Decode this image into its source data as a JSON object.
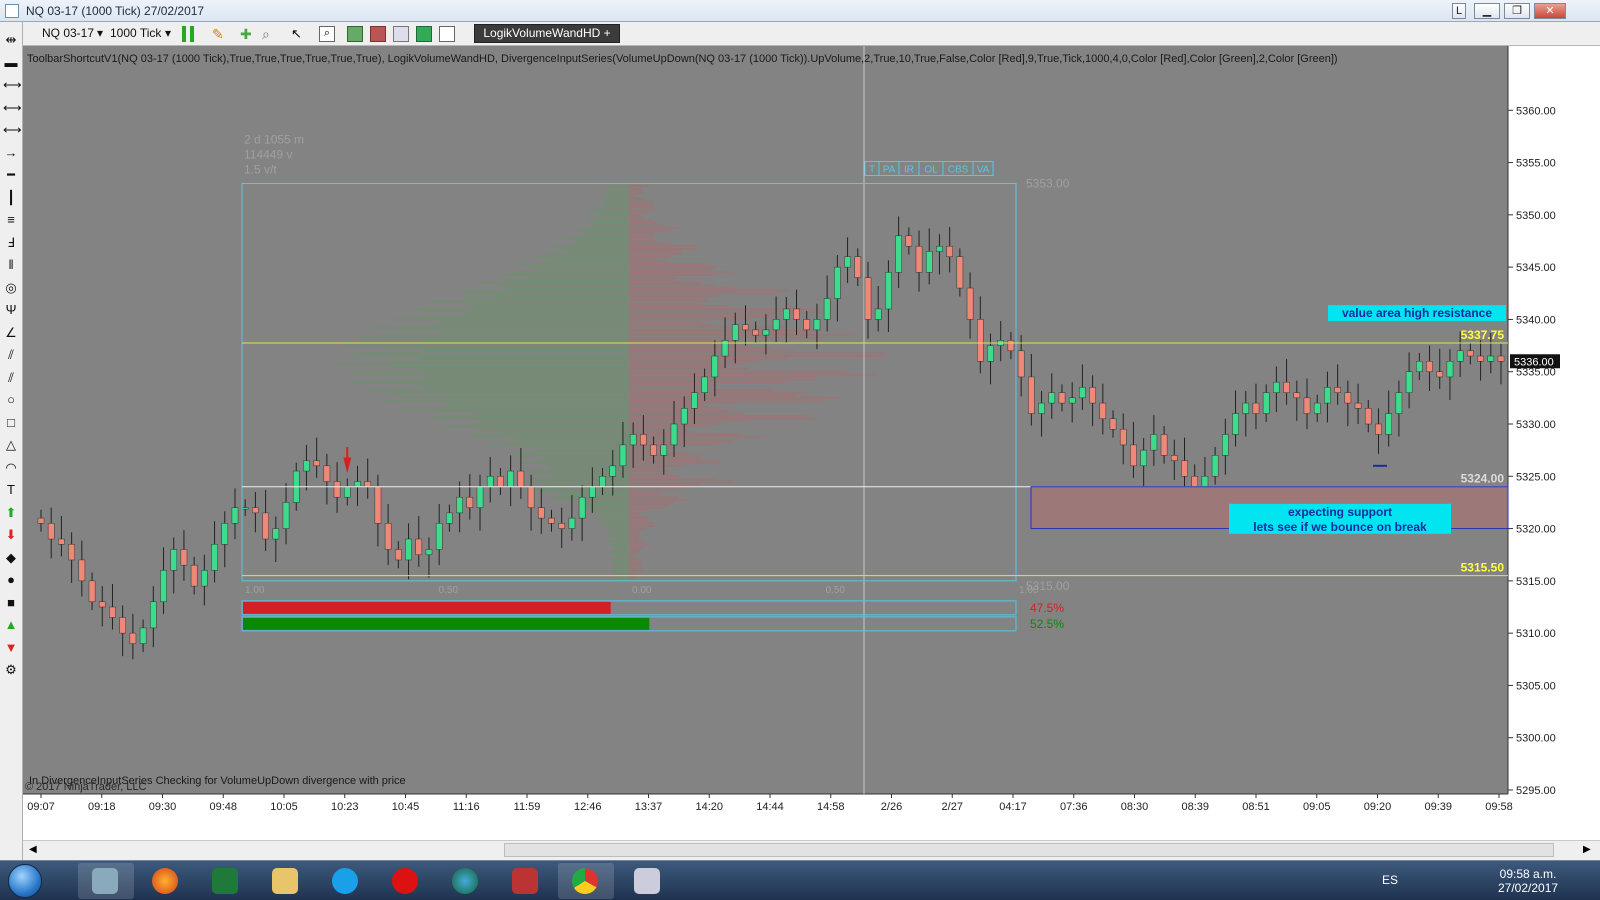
{
  "window": {
    "title": "NQ 03-17 (1000 Tick)  27/02/2017"
  },
  "toolbar": {
    "instrument": "NQ 03-17",
    "interval": "1000 Tick",
    "indicator_button": "LogikVolumeWandHD +"
  },
  "indicator_line": "ToolbarShortcutV1(NQ 03-17 (1000 Tick),True,True,True,True,True,True), LogikVolumeWandHD, DivergenceInputSeries(VolumeUpDown(NQ 03-17 (1000 Tick)).UpVolume,2,True,10,True,False,Color [Red],9,True,Tick,1000,4,0,Color [Red],Color [Green],2,Color [Green])",
  "footer_text": "In DivergenceInputSeries Checking for VolumeUpDown  divergence with price",
  "copyright": "© 2017 NinjaTrader, LLC",
  "colors": {
    "bg": "#838383",
    "up": "#3cdc8c",
    "down": "#f08878",
    "accent_cyan": "#00e5ef",
    "yellow": "#ffff44",
    "grid": "#979797"
  },
  "chart_data": {
    "type": "candlestick",
    "y_axis": {
      "min": 5295,
      "max": 5365,
      "ticks": [
        "5360.00",
        "5355.00",
        "5350.00",
        "5345.00",
        "5340.00",
        "5335.00",
        "5330.00",
        "5325.00",
        "5320.00",
        "5315.00",
        "5310.00",
        "5305.00",
        "5300.00",
        "5295.00"
      ],
      "current_price": "5336.00"
    },
    "x_axis": {
      "ticks": [
        "09:07",
        "09:18",
        "09:30",
        "09:48",
        "10:05",
        "10:23",
        "10:45",
        "11:16",
        "11:59",
        "12:46",
        "13:37",
        "14:20",
        "14:44",
        "14:58",
        "2/26",
        "2/27",
        "04:17",
        "07:36",
        "08:30",
        "08:39",
        "08:51",
        "09:05",
        "09:20",
        "09:39",
        "09:58"
      ]
    },
    "levels": [
      {
        "label": "5337.75",
        "price": 5337.75
      },
      {
        "label": "5324.00",
        "price": 5324.0
      },
      {
        "label": "5315.50",
        "price": 5315.5
      }
    ],
    "annotations": {
      "resistance": "value area high resistance",
      "support_line1": "expecting support",
      "support_line2": "lets see if we bounce  on break"
    },
    "profile_box": {
      "stats": [
        "2 d 1055 m",
        "114449 v",
        "1.5 v/t"
      ],
      "high_label": "5353.00",
      "low_label": "5315.00",
      "tabs": [
        "T",
        "PA",
        "IR",
        "OL",
        "CBS",
        "VA"
      ],
      "scale_labels": [
        "1.00",
        "0.50",
        "0.00",
        "0.50",
        "1.00"
      ],
      "sell_pct": "47.5%",
      "buy_pct": "52.5%",
      "sell_fraction": 0.475,
      "buy_fraction": 0.525
    },
    "closes": [
      5320.5,
      5319.0,
      5318.5,
      5317.0,
      5315.0,
      5313.0,
      5312.5,
      5311.5,
      5310.0,
      5309.0,
      5310.5,
      5313.0,
      5316.0,
      5318.0,
      5316.5,
      5314.5,
      5316.0,
      5318.5,
      5320.5,
      5322.0,
      5322.0,
      5321.5,
      5319.0,
      5320.0,
      5322.5,
      5325.5,
      5326.5,
      5326.0,
      5324.5,
      5323.0,
      5324.0,
      5324.5,
      5324.0,
      5320.5,
      5318.0,
      5317.0,
      5319.0,
      5317.5,
      5318.0,
      5320.5,
      5321.5,
      5323.0,
      5322.0,
      5324.0,
      5325.0,
      5324.0,
      5325.5,
      5324.0,
      5322.0,
      5321.0,
      5320.5,
      5320.0,
      5321.0,
      5323.0,
      5324.0,
      5325.0,
      5326.0,
      5328.0,
      5329.0,
      5328.0,
      5327.0,
      5328.0,
      5330.0,
      5331.5,
      5333.0,
      5334.5,
      5336.5,
      5338.0,
      5339.5,
      5339.0,
      5338.5,
      5339.0,
      5340.0,
      5341.0,
      5340.0,
      5339.0,
      5340.0,
      5342.0,
      5345.0,
      5346.0,
      5344.0,
      5340.0,
      5341.0,
      5344.5,
      5348.0,
      5347.0,
      5344.5,
      5346.5,
      5347.0,
      5346.0,
      5343.0,
      5340.0,
      5336.0,
      5337.5,
      5338.0,
      5337.0,
      5334.5,
      5331.0,
      5332.0,
      5333.0,
      5332.0,
      5332.5,
      5333.5,
      5332.0,
      5330.5,
      5329.5,
      5328.0,
      5326.0,
      5327.5,
      5329.0,
      5327.0,
      5326.5,
      5325.0,
      5323.5,
      5325.0,
      5327.0,
      5329.0,
      5331.0,
      5332.0,
      5331.0,
      5333.0,
      5334.0,
      5333.0,
      5332.5,
      5331.0,
      5332.0,
      5333.5,
      5333.0,
      5332.0,
      5331.5,
      5330.0,
      5329.0,
      5331.0,
      5333.0,
      5335.0,
      5336.0,
      5335.0,
      5334.5,
      5336.0,
      5337.0,
      5336.5,
      5336.0,
      5336.5,
      5336.0
    ]
  }
}
